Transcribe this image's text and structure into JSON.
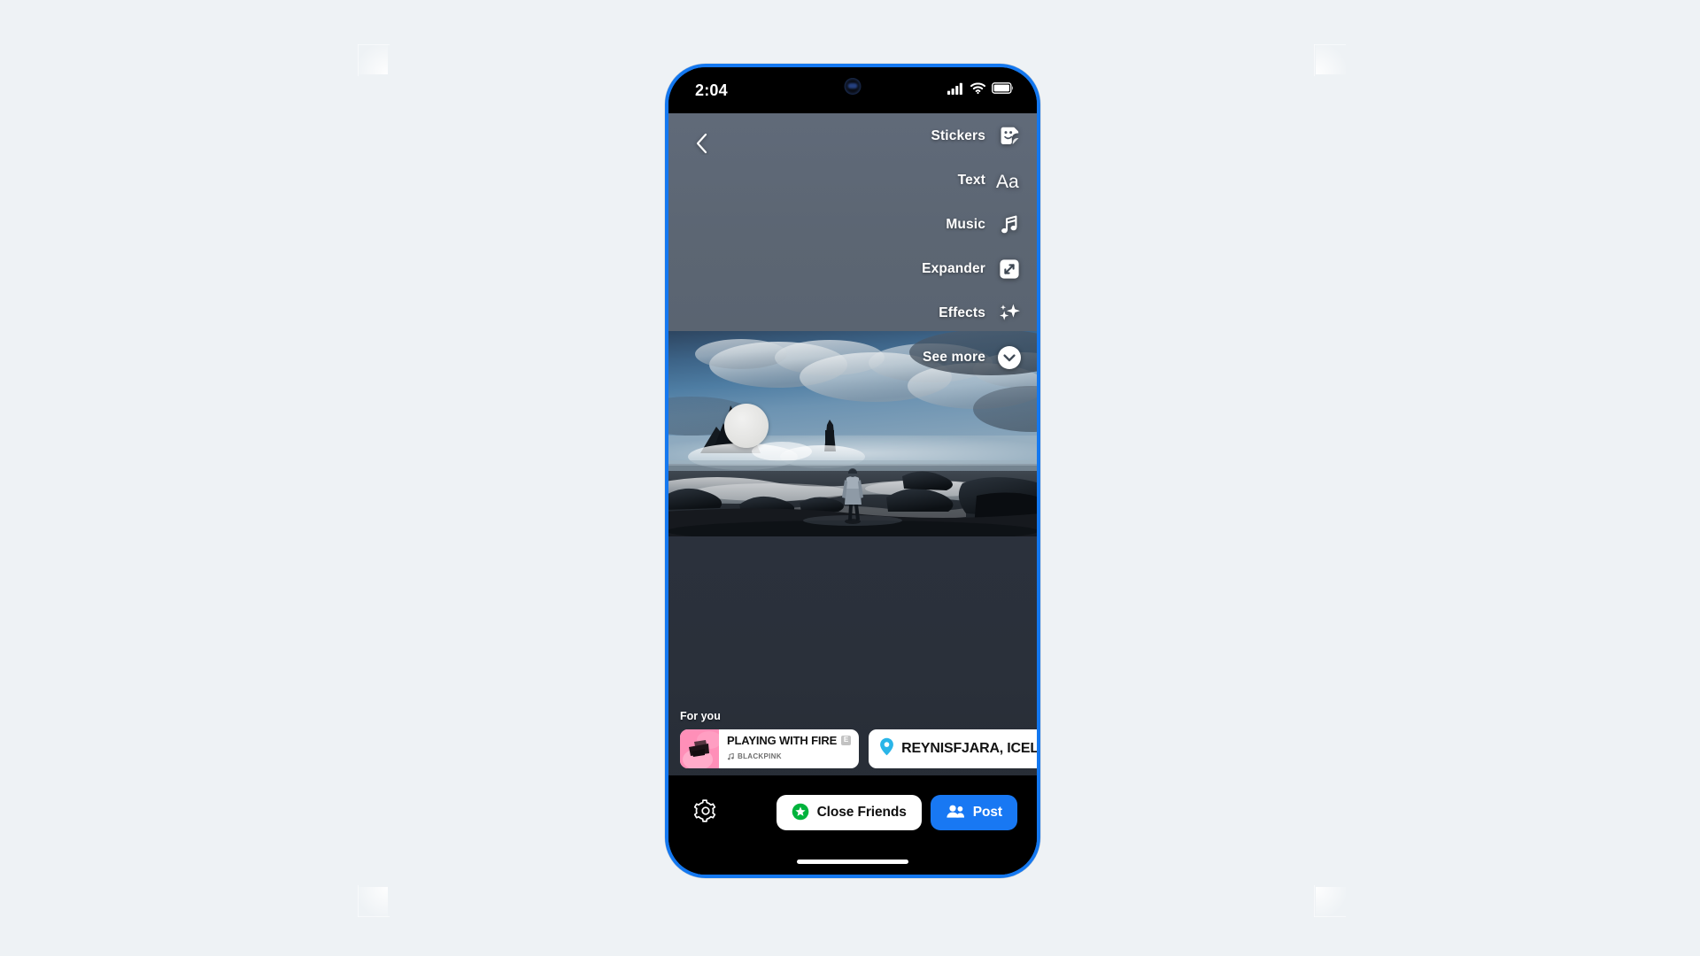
{
  "canvas": {
    "background_color": "#eef2f5",
    "device_frame_color": "#1478f0"
  },
  "status_bar": {
    "time": "2:04",
    "icons": [
      "cellular-signal-icon",
      "wifi-icon",
      "battery-icon"
    ]
  },
  "navigation": {
    "back_label": "Back",
    "back_icon": "chevron-left-icon"
  },
  "tool_menu": {
    "items": [
      {
        "label": "Stickers",
        "icon": "sticker-icon"
      },
      {
        "label": "Text",
        "icon": "text-aa-icon"
      },
      {
        "label": "Music",
        "icon": "music-note-icon"
      },
      {
        "label": "Expander",
        "icon": "expand-arrows-icon"
      },
      {
        "label": "Effects",
        "icon": "sparkles-icon"
      },
      {
        "label": "See more",
        "icon": "chevron-down-circle-icon"
      }
    ]
  },
  "story_canvas": {
    "photo_description": "Person walking on black sand beach with sea stacks and crashing waves",
    "overlay_shape": "white-circle-overlay"
  },
  "suggestions": {
    "section_label": "For you",
    "music_sticker": {
      "title": "PLAYING WITH FIRE",
      "artist": "BLACKPINK",
      "explicit_badge": "E",
      "album_art": "album-art-pink"
    },
    "location_sticker": {
      "text": "REYNISFJARA, ICELAND",
      "icon": "location-pin-icon",
      "pin_color": "#2ab5e8"
    }
  },
  "action_bar": {
    "settings_icon": "gear-icon",
    "close_friends": {
      "label": "Close Friends",
      "icon": "green-star-icon",
      "accent_color": "#00b33c"
    },
    "post": {
      "label": "Post",
      "icon": "people-group-icon",
      "accent_color": "#1878f3"
    }
  }
}
